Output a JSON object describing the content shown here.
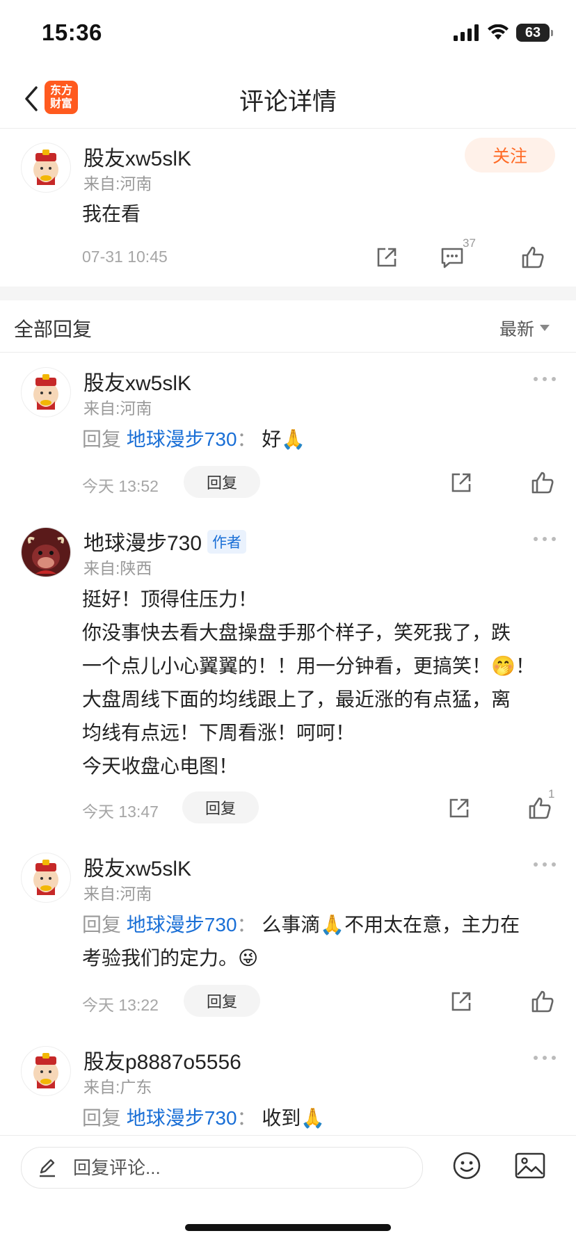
{
  "status_bar": {
    "time": "15:36",
    "battery": "63"
  },
  "nav": {
    "title": "评论详情",
    "logo_line1": "东方",
    "logo_line2": "财富"
  },
  "main_comment": {
    "username": "股友xw5slK",
    "location": "来自:河南",
    "follow_label": "关注",
    "text": "我在看",
    "timestamp": "07-31 10:45",
    "reply_count": "37"
  },
  "replies_header": {
    "title": "全部回复",
    "sort_label": "最新"
  },
  "replies": [
    {
      "username": "股友xw5slK",
      "location": "来自:河南",
      "reply_prefix": "回复",
      "reply_to": "地球漫步730",
      "separator": "：",
      "text": "好🙏",
      "timestamp": "今天 13:52",
      "reply_label": "回复"
    },
    {
      "username": "地球漫步730",
      "author_badge": "作者",
      "location": "来自:陕西",
      "lines": [
        "挺好！顶得住压力！",
        "你没事快去看大盘操盘手那个样子，笑死我了，跌",
        "一个点儿小心翼翼的！！用一分钟看，更搞笑！🤭！",
        "大盘周线下面的均线跟上了，最近涨的有点猛，离",
        "均线有点远！下周看涨！呵呵！",
        "今天收盘心电图！"
      ],
      "timestamp": "今天 13:47",
      "reply_label": "回复",
      "like_count": "1"
    },
    {
      "username": "股友xw5slK",
      "location": "来自:河南",
      "reply_prefix": "回复",
      "reply_to": "地球漫步730",
      "separator": "：",
      "text_line1": "么事滴🙏不用太在意，主力在",
      "text_line2": "考验我们的定力。😜",
      "timestamp": "今天 13:22",
      "reply_label": "回复"
    },
    {
      "username": "股友p8887o5556",
      "location": "来自:广东",
      "reply_prefix": "回复",
      "reply_to": "地球漫步730",
      "separator": "：",
      "text": "收到🙏"
    }
  ],
  "bottom_bar": {
    "placeholder": "回复评论..."
  },
  "colors": {
    "brand": "#ff5a1f",
    "link": "#1a6fd6",
    "follow_bg": "#fff1e9",
    "follow_text": "#ff6b26"
  },
  "icons": [
    "back-icon",
    "share-icon",
    "comment-icon",
    "like-icon",
    "more-icon",
    "edit-icon",
    "emoji-icon",
    "image-icon",
    "signal-icon",
    "wifi-icon",
    "battery-icon"
  ]
}
